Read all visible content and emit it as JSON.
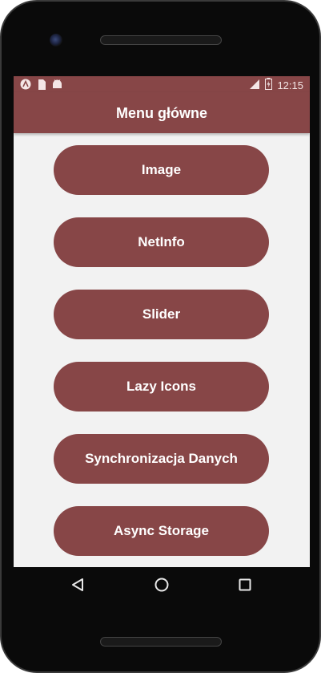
{
  "status_bar": {
    "time": "12:15",
    "left_icons": [
      "app-a-icon",
      "sim-card-icon",
      "android-icon"
    ],
    "right_icons": [
      "signal-icon",
      "battery-charging-icon"
    ]
  },
  "app_bar": {
    "title": "Menu główne"
  },
  "menu": {
    "items": [
      {
        "label": "Image"
      },
      {
        "label": "NetInfo"
      },
      {
        "label": "Slider"
      },
      {
        "label": "Lazy Icons"
      },
      {
        "label": "Synchronizacja Danych"
      },
      {
        "label": "Async Storage"
      }
    ]
  },
  "nav_bar": {
    "icons": [
      "back-icon",
      "home-icon",
      "recents-icon"
    ]
  },
  "colors": {
    "primary": "#874647",
    "background": "#f2f2f2",
    "text_on_primary": "#ffffff"
  }
}
